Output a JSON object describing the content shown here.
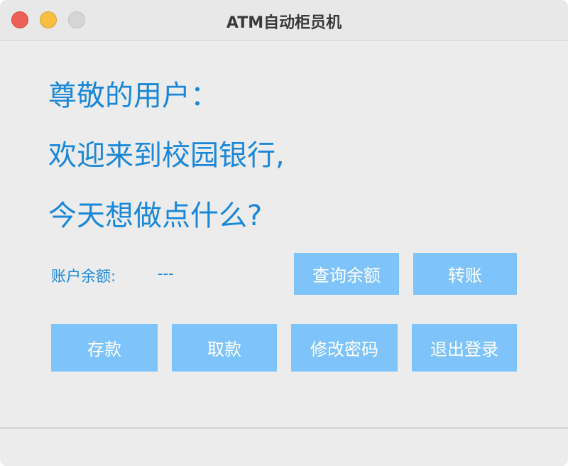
{
  "window": {
    "title": "ATM自动柜员机"
  },
  "greeting": {
    "line1": "尊敬的用户：",
    "line2": "欢迎来到校园银行,",
    "line3": "今天想做点什么?"
  },
  "account": {
    "balance_label": "账户余额:",
    "balance_value": "---"
  },
  "buttons": {
    "query_balance": "查询余额",
    "transfer": "转账",
    "deposit": "存款",
    "withdraw": "取款",
    "change_password": "修改密码",
    "logout": "退出登录"
  },
  "colors": {
    "accent_text": "#1a87d8",
    "button_bg": "#7fc3fb",
    "window_bg": "#ececec",
    "close": "#ee5f58",
    "minimize": "#f8be3f",
    "maximize": "#d5d5d5"
  }
}
